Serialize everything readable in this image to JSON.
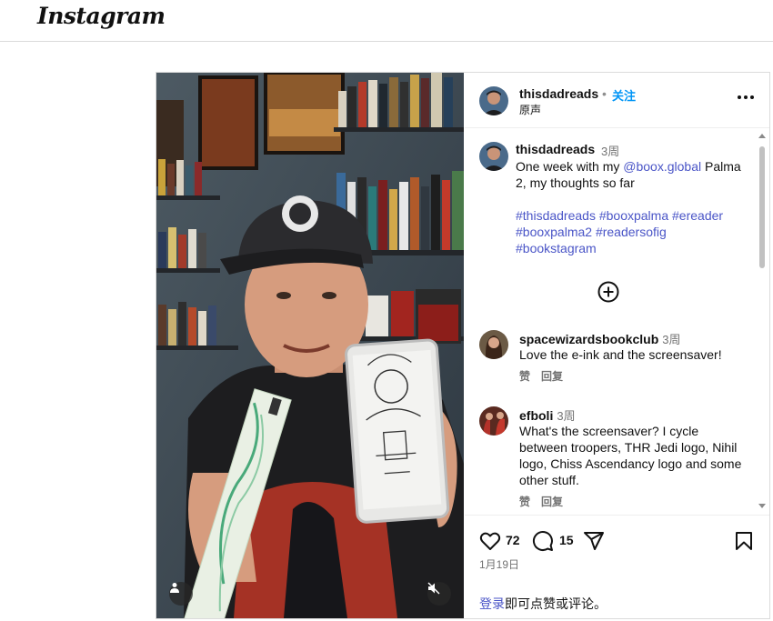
{
  "app": {
    "logo_text": "Instagram"
  },
  "post": {
    "author": {
      "username": "thisdadreads",
      "dot": "•",
      "follow_label": "关注",
      "audio_label": "原声"
    },
    "caption": {
      "username": "thisdadreads",
      "time": "3周",
      "text_before": "One week with my ",
      "mention": "@boox.global",
      "text_after": " Palma 2, my thoughts so far",
      "hashtags": "#thisdadreads #booxpalma #ereader #booxpalma2 #readersofig #bookstagram"
    },
    "comments": [
      {
        "username": "spacewizardsbookclub",
        "time": "3周",
        "text": "Love the e-ink and the screensaver!",
        "like_label": "赞",
        "reply_label": "回复"
      },
      {
        "username": "efboli",
        "time": "3周",
        "text": "What's the screensaver? I cycle between troopers, THR Jedi logo, Nihil logo, Chiss Ascendancy logo and some other stuff.",
        "like_label": "赞",
        "reply_label": "回复"
      }
    ],
    "stats": {
      "likes": "72",
      "comments": "15"
    },
    "date": "1月19日",
    "login_prompt": {
      "link": "登录",
      "text": "即可点赞或评论。"
    }
  },
  "icons": {
    "more": "more-options-icon",
    "load_more": "plus-circle-icon",
    "like": "heart-icon",
    "comment": "comment-bubble-icon",
    "share": "paper-plane-icon",
    "save": "bookmark-icon",
    "user_tag": "user-tag-icon",
    "mute": "speaker-muted-icon"
  },
  "colors": {
    "link": "#4a55c7",
    "follow": "#0095f6",
    "muted_text": "#737373"
  }
}
